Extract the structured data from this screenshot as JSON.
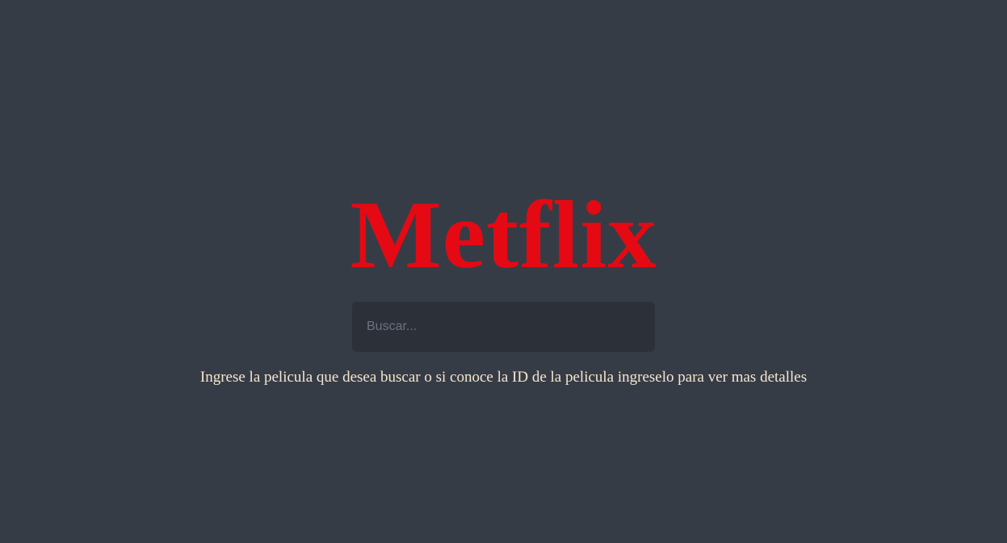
{
  "app": {
    "logo_text": "Metflix",
    "logo_color": "#e50914",
    "background_color": "#363c46"
  },
  "search": {
    "placeholder": "Buscar...",
    "value": ""
  },
  "hint": {
    "text": "Ingrese la pelicula que desea buscar o si conoce la ID de la pelicula ingreselo para ver mas detalles"
  }
}
